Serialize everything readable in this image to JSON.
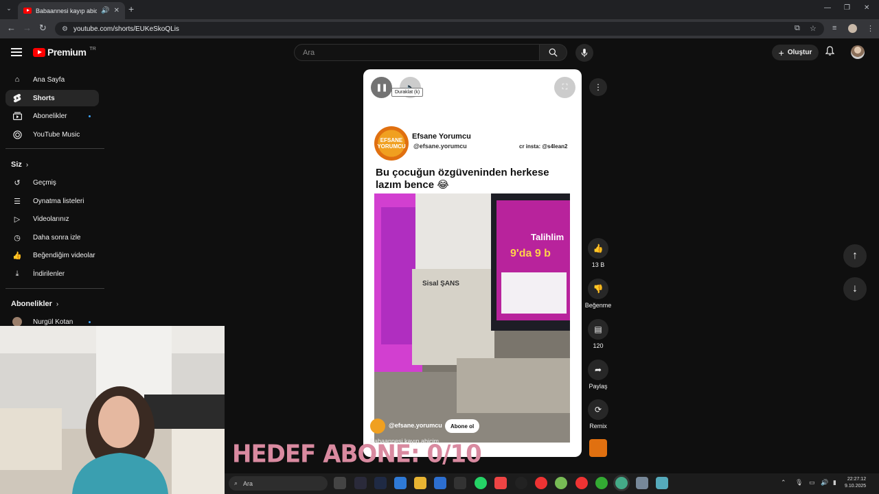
{
  "browser": {
    "tab_title": "Babaannesi kayıp abicim - YouTube",
    "url": "youtube.com/shorts/EUKeSkoQLis"
  },
  "header": {
    "logo_text": "Premium",
    "country_code": "TR",
    "search_placeholder": "Ara",
    "create_label": "Oluştur"
  },
  "sidebar": {
    "main": [
      {
        "label": "Ana Sayfa",
        "icon": "home-icon"
      },
      {
        "label": "Shorts",
        "icon": "shorts-icon",
        "active": true
      },
      {
        "label": "Abonelikler",
        "icon": "subscriptions-icon",
        "dot": true
      },
      {
        "label": "YouTube Music",
        "icon": "music-icon"
      }
    ],
    "you_title": "Siz",
    "you": [
      {
        "label": "Geçmiş",
        "icon": "history-icon"
      },
      {
        "label": "Oynatma listeleri",
        "icon": "playlists-icon"
      },
      {
        "label": "Videolarınız",
        "icon": "your-videos-icon"
      },
      {
        "label": "Daha sonra izle",
        "icon": "watch-later-icon"
      },
      {
        "label": "Beğendiğim videolar",
        "icon": "liked-icon"
      },
      {
        "label": "İndirilenler",
        "icon": "downloads-icon"
      }
    ],
    "subs_title": "Abonelikler",
    "subs": [
      {
        "label": "Nurgül Kotan",
        "dot": true
      }
    ]
  },
  "player": {
    "tooltip": "Duraklat (k)",
    "channel_name": "Efsane Yorumcu",
    "channel_handle": "@efsane.yorumcu",
    "logo_text": "EFSANE YORUMCU",
    "credit": "cr insta: @s4lean2",
    "caption": "Bu çocuğun özgüveninden herkese lazım bence 😂",
    "video_sign_1": "Talihlim",
    "video_sign_2": "9'da 9 b",
    "video_brand": "Sisal ŞANS",
    "overlay_handle": "@efsane.yorumcu",
    "subscribe_label": "Abone ol",
    "video_title": "Babaannesi kayıp abicim"
  },
  "actions": {
    "like_count": "13 B",
    "dislike_label": "Beğenme",
    "comment_count": "120",
    "share_label": "Paylaş",
    "remix_label": "Remix"
  },
  "overlay": {
    "goal_text": "HEDEF ABONE: 0/10"
  },
  "taskbar": {
    "search_placeholder": "Ara",
    "time": "22:27:12",
    "date": "9.10.2025"
  }
}
